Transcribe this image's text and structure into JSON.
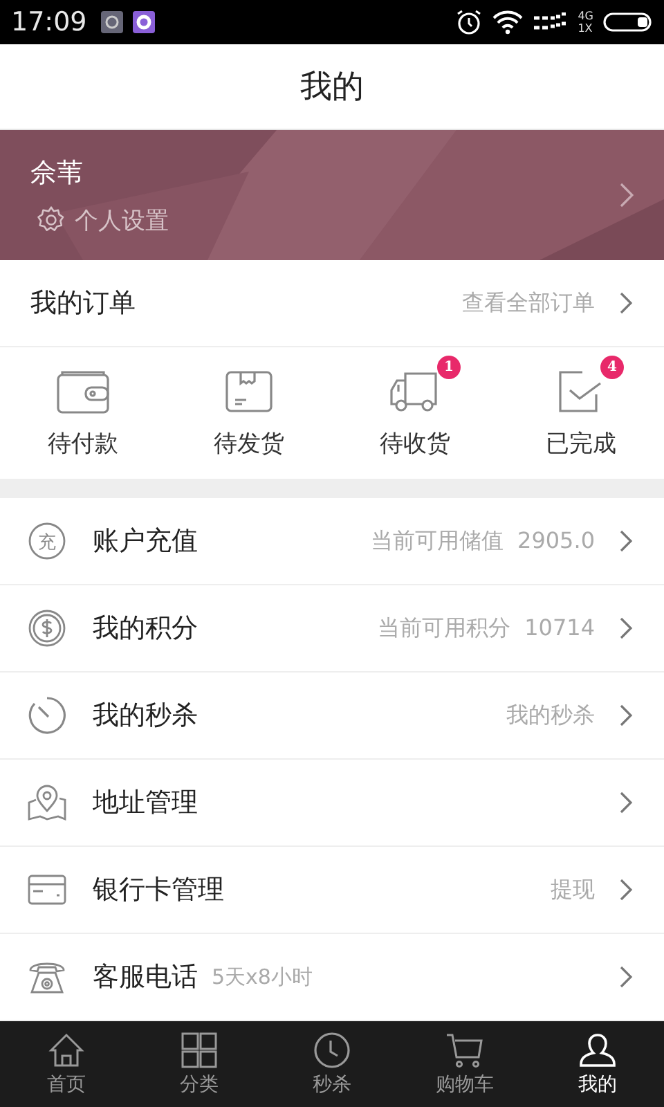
{
  "status_bar": {
    "time": "17:09",
    "network_top": "4G",
    "network_bottom": "1X"
  },
  "title": "我的",
  "profile": {
    "name": "佘苇",
    "settings_label": "个人设置"
  },
  "orders": {
    "title": "我的订单",
    "link": "查看全部订单",
    "statuses": [
      {
        "kind": "wallet",
        "label": "待付款"
      },
      {
        "kind": "box",
        "label": "待发货"
      },
      {
        "kind": "truck",
        "label": "待收货",
        "badge": "1"
      },
      {
        "kind": "check",
        "label": "已完成",
        "badge": "4"
      }
    ]
  },
  "menu": [
    {
      "kind": "recharge",
      "icon_char": "充",
      "label": "账户充值",
      "value": "当前可用储值  2905.0"
    },
    {
      "kind": "points",
      "label": "我的积分",
      "value": "当前可用积分  10714"
    },
    {
      "kind": "timer",
      "label": "我的秒杀",
      "value": "我的秒杀"
    },
    {
      "kind": "location",
      "label": "地址管理"
    },
    {
      "kind": "card",
      "label": "银行卡管理",
      "value": "提现"
    },
    {
      "kind": "phone",
      "label": "客服电话",
      "note": "5天x8小时"
    }
  ],
  "tab_bar": [
    {
      "kind": "home",
      "label": "首页",
      "selected": false
    },
    {
      "kind": "grid",
      "label": "分类",
      "selected": false
    },
    {
      "kind": "clock",
      "label": "秒杀",
      "selected": false
    },
    {
      "kind": "cart",
      "label": "购物车",
      "selected": false
    },
    {
      "kind": "user",
      "label": "我的",
      "selected": true
    }
  ]
}
